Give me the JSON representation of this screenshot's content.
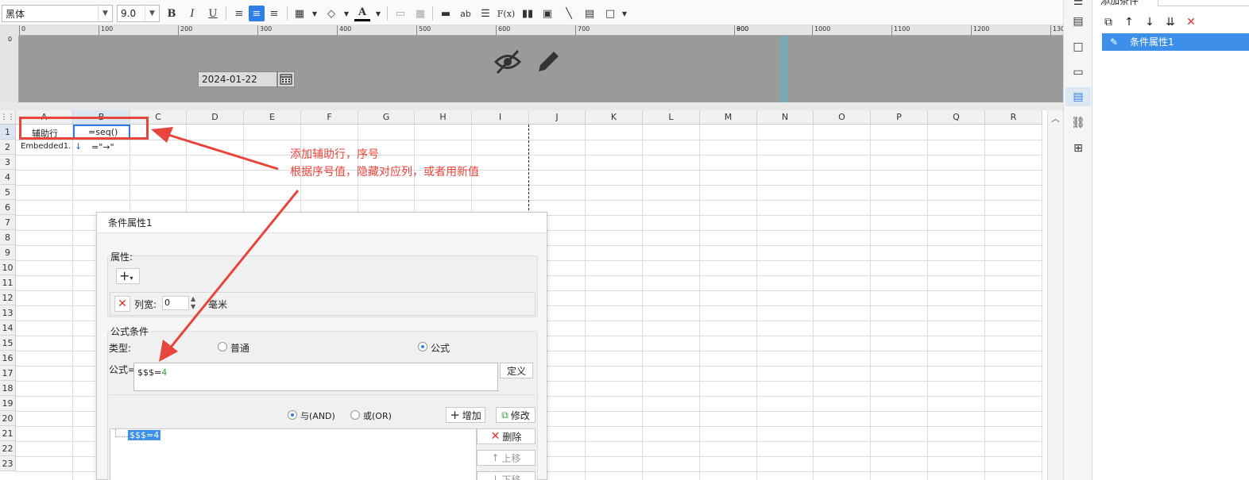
{
  "toolbar": {
    "font_name": "黑体",
    "font_size": "9.0",
    "bold_label": "B",
    "italic_label": "I",
    "underline_label": "U",
    "text_color_label": "A"
  },
  "ruler": {
    "ticks": [
      "0",
      "100",
      "200",
      "300",
      "400",
      "500",
      "600",
      "700",
      "800",
      "900",
      "1000",
      "1100",
      "1200",
      "130"
    ],
    "vertical_tick": "0"
  },
  "header_area": {
    "date_value": "2024-01-22"
  },
  "grid": {
    "columns": [
      "A",
      "B",
      "C",
      "D",
      "E",
      "F",
      "G",
      "H",
      "I",
      "J",
      "K",
      "L",
      "M",
      "N",
      "O",
      "P",
      "Q",
      "R"
    ],
    "rows": [
      "1",
      "2",
      "3",
      "4",
      "5",
      "6",
      "7",
      "8",
      "9",
      "10",
      "11",
      "12",
      "13",
      "14",
      "15",
      "16",
      "17",
      "18",
      "19",
      "20",
      "21",
      "22",
      "23"
    ],
    "cells": {
      "a1": "辅助行",
      "b1": "=seq()",
      "a2": "Embedded1.",
      "b2": "=\"→\""
    }
  },
  "annotation": {
    "line1": "添加辅助行，序号",
    "line2": "根据序号值，隐藏对应列，或者用新值",
    "color": "#e8453c"
  },
  "dialog": {
    "title": "条件属性1",
    "property_section": "属性:",
    "column_width_label": "列宽:",
    "column_width_value": "0",
    "unit": "毫米",
    "formula_section": "公式条件",
    "type_label": "类型:",
    "type_normal": "普通",
    "type_formula": "公式",
    "formula_label": "公式=",
    "formula_value_prefix": "$$$=",
    "formula_value_num": "4",
    "define_button": "定义",
    "and_label": "与(AND)",
    "or_label": "或(OR)",
    "add_button": "增加",
    "modify_button": "修改",
    "delete_button": "删除",
    "move_up_button": "上移",
    "move_down_button": "下移",
    "condition_item": "$$$=4"
  },
  "right_panel": {
    "title": "添加条件",
    "item_label": "条件属性1"
  }
}
